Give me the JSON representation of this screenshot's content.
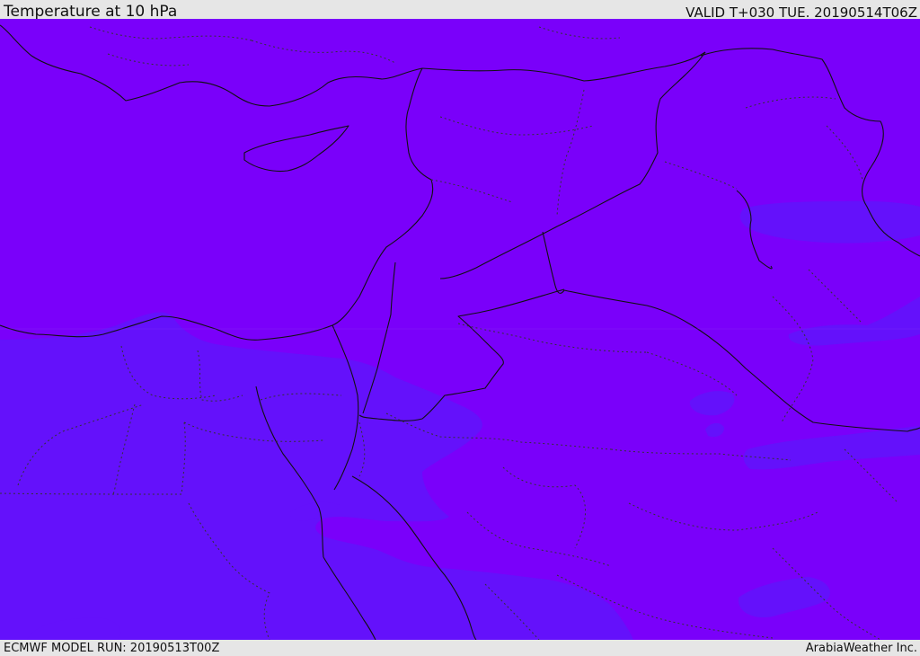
{
  "header": {
    "title": "Temperature at 10 hPa",
    "valid": "VALID T+030 TUE. 20190514T06Z"
  },
  "footer": {
    "model_run": "ECMWF MODEL RUN: 20190513T00Z",
    "credit": "ArabiaWeather Inc."
  },
  "map": {
    "field": "Temperature at 10 hPa",
    "colors": {
      "warm_band": "#7a00fa",
      "cool_band": "#6411fb",
      "coastline": "#111111",
      "borders": "#222222"
    }
  }
}
